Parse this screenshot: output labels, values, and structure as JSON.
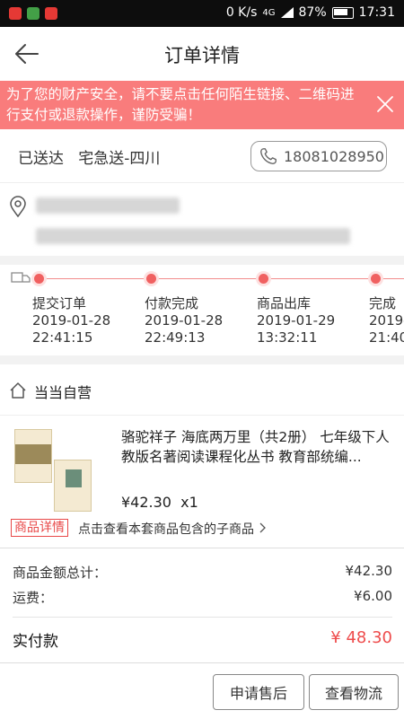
{
  "status_bar": {
    "network_speed": "0 K/s",
    "signal": "4G",
    "battery": "87%",
    "time": "17:31"
  },
  "header": {
    "title": "订单详情"
  },
  "notice": {
    "text": "为了您的财产安全，请不要点击任何陌生链接、二维码进行支付或退款操作，谨防受骗！"
  },
  "order": {
    "status": "已送达",
    "courier": "宅急送-四川",
    "phone": "18081028950"
  },
  "timeline": [
    {
      "label": "提交订单",
      "date": "2019-01-28",
      "time": "22:41:15"
    },
    {
      "label": "付款完成",
      "date": "2019-01-28",
      "time": "22:49:13"
    },
    {
      "label": "商品出库",
      "date": "2019-01-29",
      "time": "13:32:11"
    },
    {
      "label": "完成",
      "date": "2019-0",
      "time": "21:40"
    }
  ],
  "shop": {
    "name": "当当自营"
  },
  "product": {
    "title": "骆驼祥子 海底两万里（共2册） 七年级下人教版名著阅读课程化丛书 教育部统编...",
    "price": "¥42.30",
    "qty": "x1",
    "tag": "商品详情",
    "tag_link": "点击查看本套商品包含的子商品"
  },
  "totals": {
    "goods_label": "商品金额总计：",
    "goods_value": "¥42.30",
    "shipping_label": "运费：",
    "shipping_value": "¥6.00",
    "paid_label": "实付款",
    "paid_value": "¥ 48.30"
  },
  "footer": {
    "after_sale": "申请售后",
    "logistics": "查看物流"
  }
}
